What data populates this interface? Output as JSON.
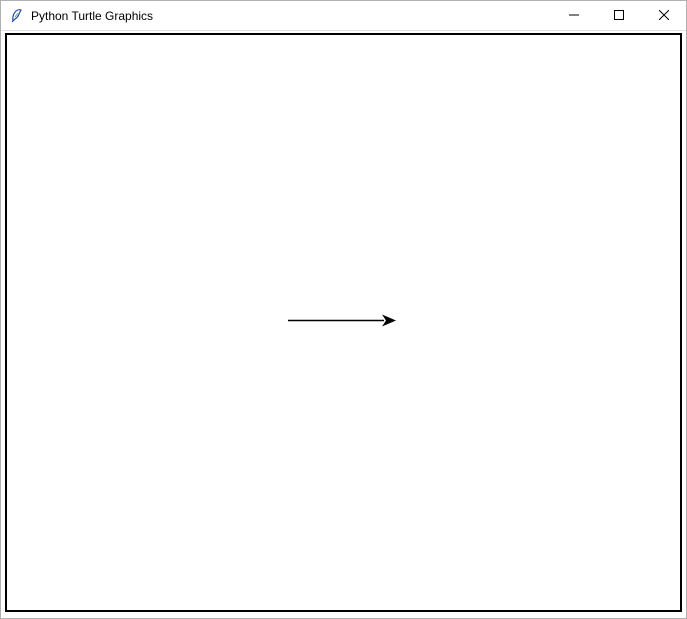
{
  "window": {
    "title": "Python Turtle Graphics",
    "icon_name": "feather"
  },
  "controls": {
    "minimize": "minimize",
    "maximize": "maximize",
    "close": "close"
  },
  "turtle": {
    "heading": 0,
    "line_length": 100,
    "position_x": 0,
    "position_y": 0
  }
}
